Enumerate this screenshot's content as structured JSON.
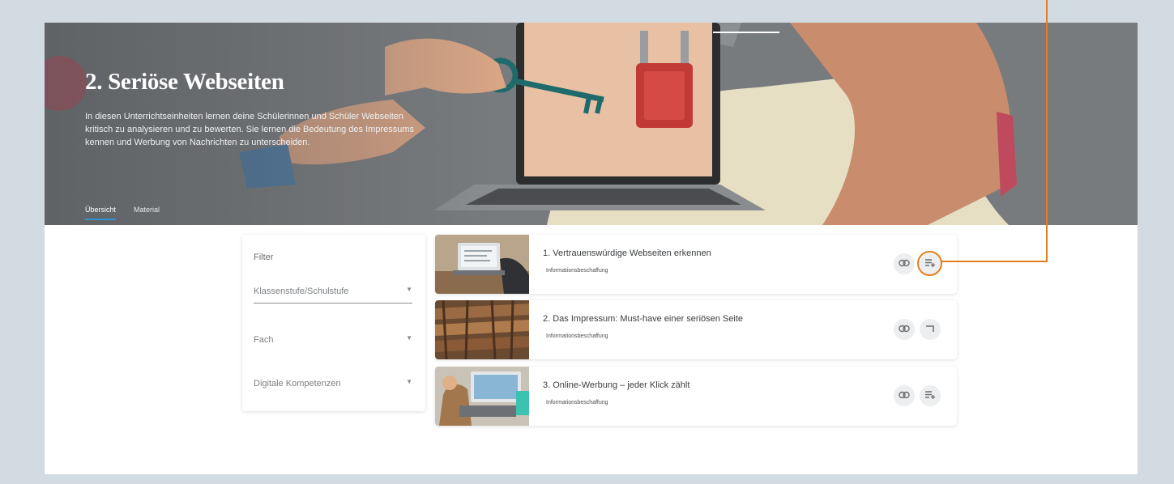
{
  "hero": {
    "title": "2. Seriöse Webseiten",
    "description": "In diesen Unterrichtseinheiten lernen deine Schülerinnen und Schüler Webseiten kritisch zu analysieren und zu bewerten. Sie lernen die Bedeutung des Impressums kennen und Werbung von Nachrichten zu unterscheiden.",
    "tabs": [
      {
        "label": "Übersicht",
        "active": true
      },
      {
        "label": "Material",
        "active": false
      }
    ]
  },
  "filter": {
    "title": "Filter",
    "selects": [
      {
        "label": "Klassenstufe/Schulstufe"
      },
      {
        "label": "Fach"
      },
      {
        "label": "Digitale Kompetenzen"
      }
    ]
  },
  "courses": [
    {
      "title": "1. Vertrauenswürdige Webseiten erkennen",
      "tag": "Informationsbeschaffung",
      "view_icon": "eye-icon",
      "add_icon": "playlist-add-icon"
    },
    {
      "title": "2. Das Impressum: Must-have einer seriösen Seite",
      "tag": "Informationsbeschaffung",
      "view_icon": "eye-icon",
      "add_icon": "bracket-icon"
    },
    {
      "title": "3. Online-Werbung – jeder Klick zählt",
      "tag": "Informationsbeschaffung",
      "view_icon": "eye-icon",
      "add_icon": "playlist-add-icon"
    }
  ],
  "colors": {
    "page_bg": "#d3dbe2",
    "accent": "#2f8fcf",
    "annotation": "#e37e1c",
    "hero_bg": "#787b7e"
  }
}
